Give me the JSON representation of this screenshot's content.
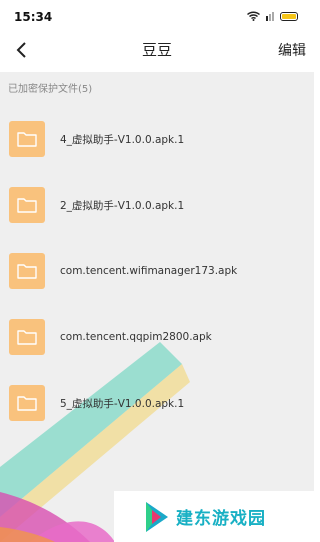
{
  "status": {
    "time": "15:34"
  },
  "nav": {
    "title": "豆豆",
    "edit_label": "编辑"
  },
  "section": {
    "label": "已加密保护文件(5)"
  },
  "files": [
    {
      "name": "4_虚拟助手-V1.0.0.apk.1"
    },
    {
      "name": "2_虚拟助手-V1.0.0.apk.1"
    },
    {
      "name": "com.tencent.wifimanager173.apk"
    },
    {
      "name": "com.tencent.qqpim2800.apk"
    },
    {
      "name": "5_虚拟助手-V1.0.0.apk.1"
    }
  ],
  "watermark": {
    "text": "建东游戏园"
  },
  "colors": {
    "folder": "#f9c27d",
    "background": "#efefef",
    "watermark": "#18b0c4",
    "battery": "#f5c518"
  }
}
